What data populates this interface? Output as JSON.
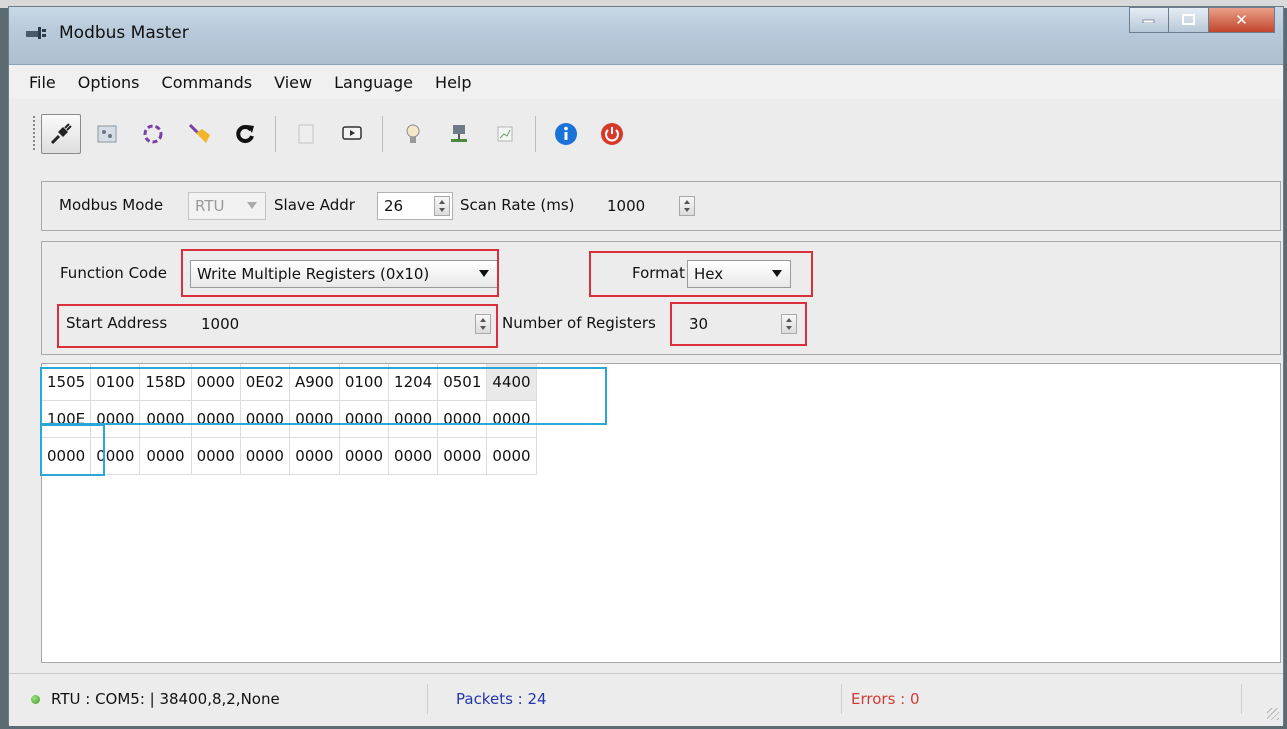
{
  "window": {
    "title": "Modbus Master"
  },
  "menu": [
    "File",
    "Options",
    "Commands",
    "View",
    "Language",
    "Help"
  ],
  "toolbar": {
    "icons": [
      "connect-icon",
      "setup-icon",
      "loop-icon",
      "clear-icon",
      "refresh-icon",
      "copy-icon",
      "monitor-icon",
      "lamp-icon",
      "network-icon",
      "chart-icon",
      "info-icon",
      "power-icon"
    ]
  },
  "mode_panel": {
    "mode_label": "Modbus Mode",
    "mode_value": "RTU",
    "slave_label": "Slave Addr",
    "slave_value": "26",
    "scan_label": "Scan Rate (ms)",
    "scan_value": "1000"
  },
  "function_panel": {
    "function_label": "Function Code",
    "function_value": "Write Multiple Registers (0x10)",
    "format_label": "Format",
    "format_value": "Hex",
    "start_label": "Start Address",
    "start_value": "1000",
    "count_label": "Number of Registers",
    "count_value": "30"
  },
  "registers": [
    [
      "1505",
      "0100",
      "158D",
      "0000",
      "0E02",
      "A900",
      "0100",
      "1204",
      "0501",
      "4400"
    ],
    [
      "100E",
      "0000",
      "0000",
      "0000",
      "0000",
      "0000",
      "0000",
      "0000",
      "0000",
      "0000"
    ],
    [
      "0000",
      "0000",
      "0000",
      "0000",
      "0000",
      "0000",
      "0000",
      "0000",
      "0000",
      "0000"
    ]
  ],
  "status": {
    "port": "RTU : COM5: | 38400,8,2,None",
    "packets": "Packets : 24",
    "errors": "Errors : 0"
  },
  "colors": {
    "highlight_red": "#d9303c",
    "highlight_blue": "#2aa6d9"
  }
}
